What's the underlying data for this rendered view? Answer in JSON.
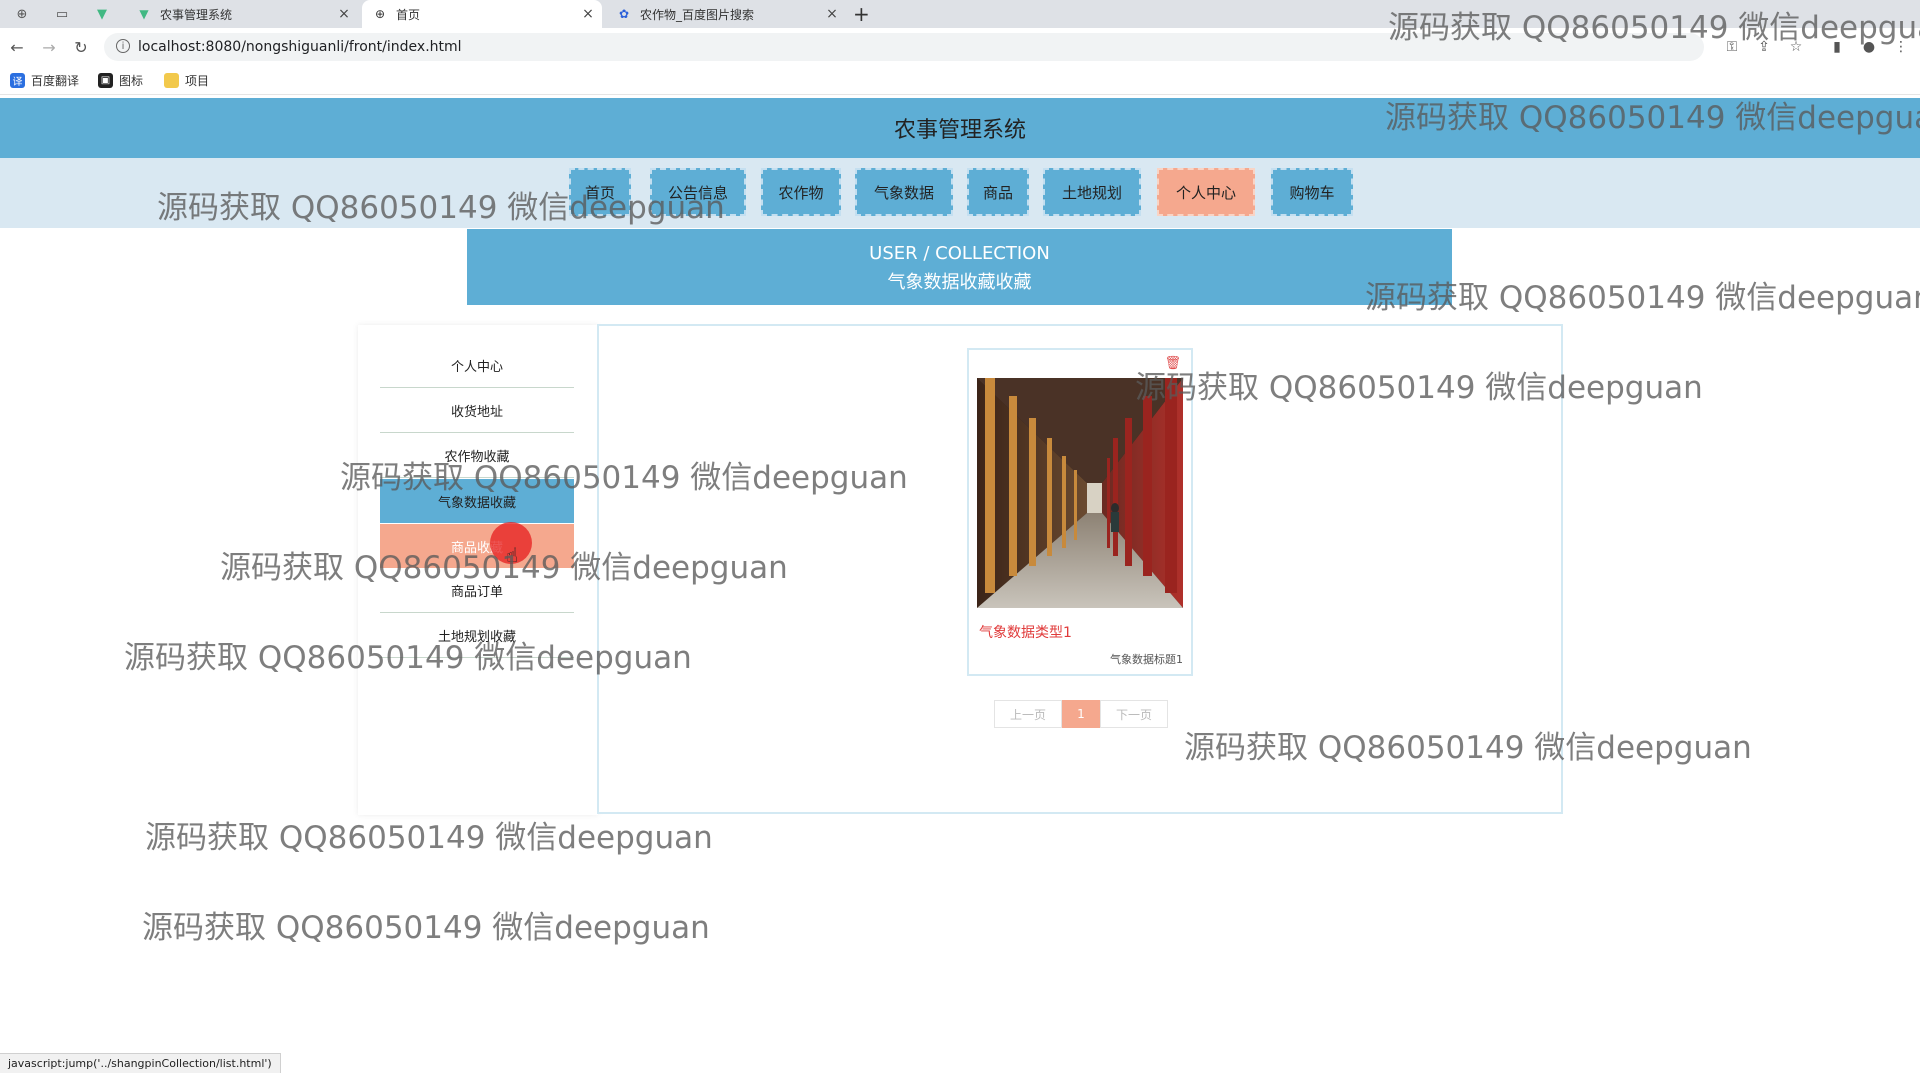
{
  "browser": {
    "tabs": [
      {
        "title": "农事管理系统",
        "icon": "vue-logo-icon",
        "active": false
      },
      {
        "title": "首页",
        "icon": "globe-icon",
        "active": true
      },
      {
        "title": "农作物_百度图片搜索",
        "icon": "baidu-paw-icon",
        "active": false
      }
    ],
    "new_tab_label": "+",
    "url": "localhost:8080/nongshiguanli/front/index.html",
    "bookmarks": [
      {
        "label": "百度翻译",
        "color": "#2b6fe0"
      },
      {
        "label": "图标",
        "color": "#222222"
      },
      {
        "label": "项目",
        "color": "#f2c94c"
      }
    ]
  },
  "site": {
    "title": "农事管理系统"
  },
  "nav": {
    "items": [
      "首页",
      "公告信息",
      "农作物",
      "气象数据",
      "商品",
      "土地规划",
      "个人中心",
      "购物车"
    ],
    "active": "个人中心"
  },
  "banner": {
    "en": "USER / COLLECTION",
    "zh": "气象数据收藏收藏"
  },
  "sidebar": {
    "items": [
      "个人中心",
      "收货地址",
      "农作物收藏",
      "气象数据收藏",
      "商品收藏",
      "商品订单",
      "土地规划收藏"
    ],
    "active": "气象数据收藏",
    "hover": "商品收藏"
  },
  "collection": {
    "items": [
      {
        "title": "气象数据类型1",
        "subtitle": "气象数据标题1"
      }
    ]
  },
  "pager": {
    "prev": "上一页",
    "current": "1",
    "next": "下一页"
  },
  "status_bar": "javascript:jump('../shangpinCollection/list.html')",
  "watermark": "源码获取 QQ86050149 微信deepguan",
  "colors": {
    "primary": "#5eaed5",
    "accent": "#f5a88e",
    "nav_bg": "#d9e8f2",
    "title_red": "#e03a3a"
  }
}
